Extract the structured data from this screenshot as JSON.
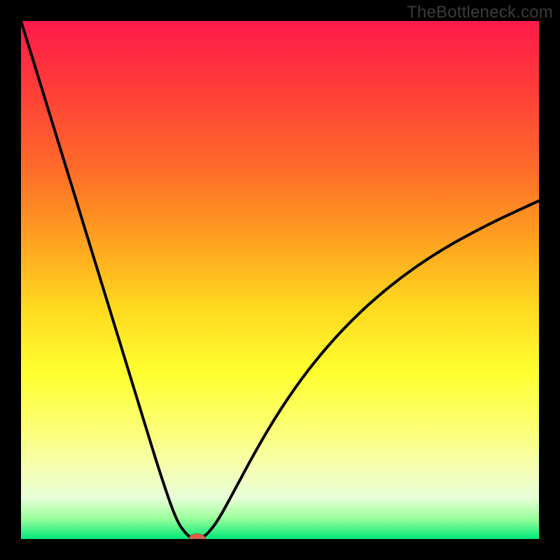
{
  "attribution": "TheBottleneck.com",
  "colors": {
    "frame": "#000000",
    "curve": "#000000",
    "marker_fill": "#d8604a",
    "marker_stroke": "#b84a36",
    "gradient_top": "#ff1a4b",
    "gradient_bottom": "#00e878"
  },
  "chart_data": {
    "type": "line",
    "title": "",
    "xlabel": "",
    "ylabel": "",
    "xlim": [
      0,
      100
    ],
    "ylim": [
      0,
      100
    ],
    "series": [
      {
        "name": "bottleneck-curve",
        "x": [
          0,
          3,
          6,
          9,
          12,
          15,
          18,
          21,
          24,
          27,
          30,
          32,
          33,
          34,
          35,
          36,
          38,
          41,
          45,
          50,
          56,
          63,
          71,
          80,
          90,
          100
        ],
        "y": [
          100,
          90.3,
          80.5,
          70.8,
          61.0,
          51.2,
          41.5,
          31.7,
          21.9,
          12.2,
          3.5,
          0.8,
          0.2,
          0.0,
          0.3,
          1.0,
          3.5,
          9.0,
          16.5,
          25.0,
          33.5,
          41.5,
          48.8,
          55.2,
          60.7,
          65.3
        ]
      }
    ],
    "marker": {
      "x": 34,
      "y": 0,
      "rx": 1.6,
      "ry": 1.0
    }
  }
}
